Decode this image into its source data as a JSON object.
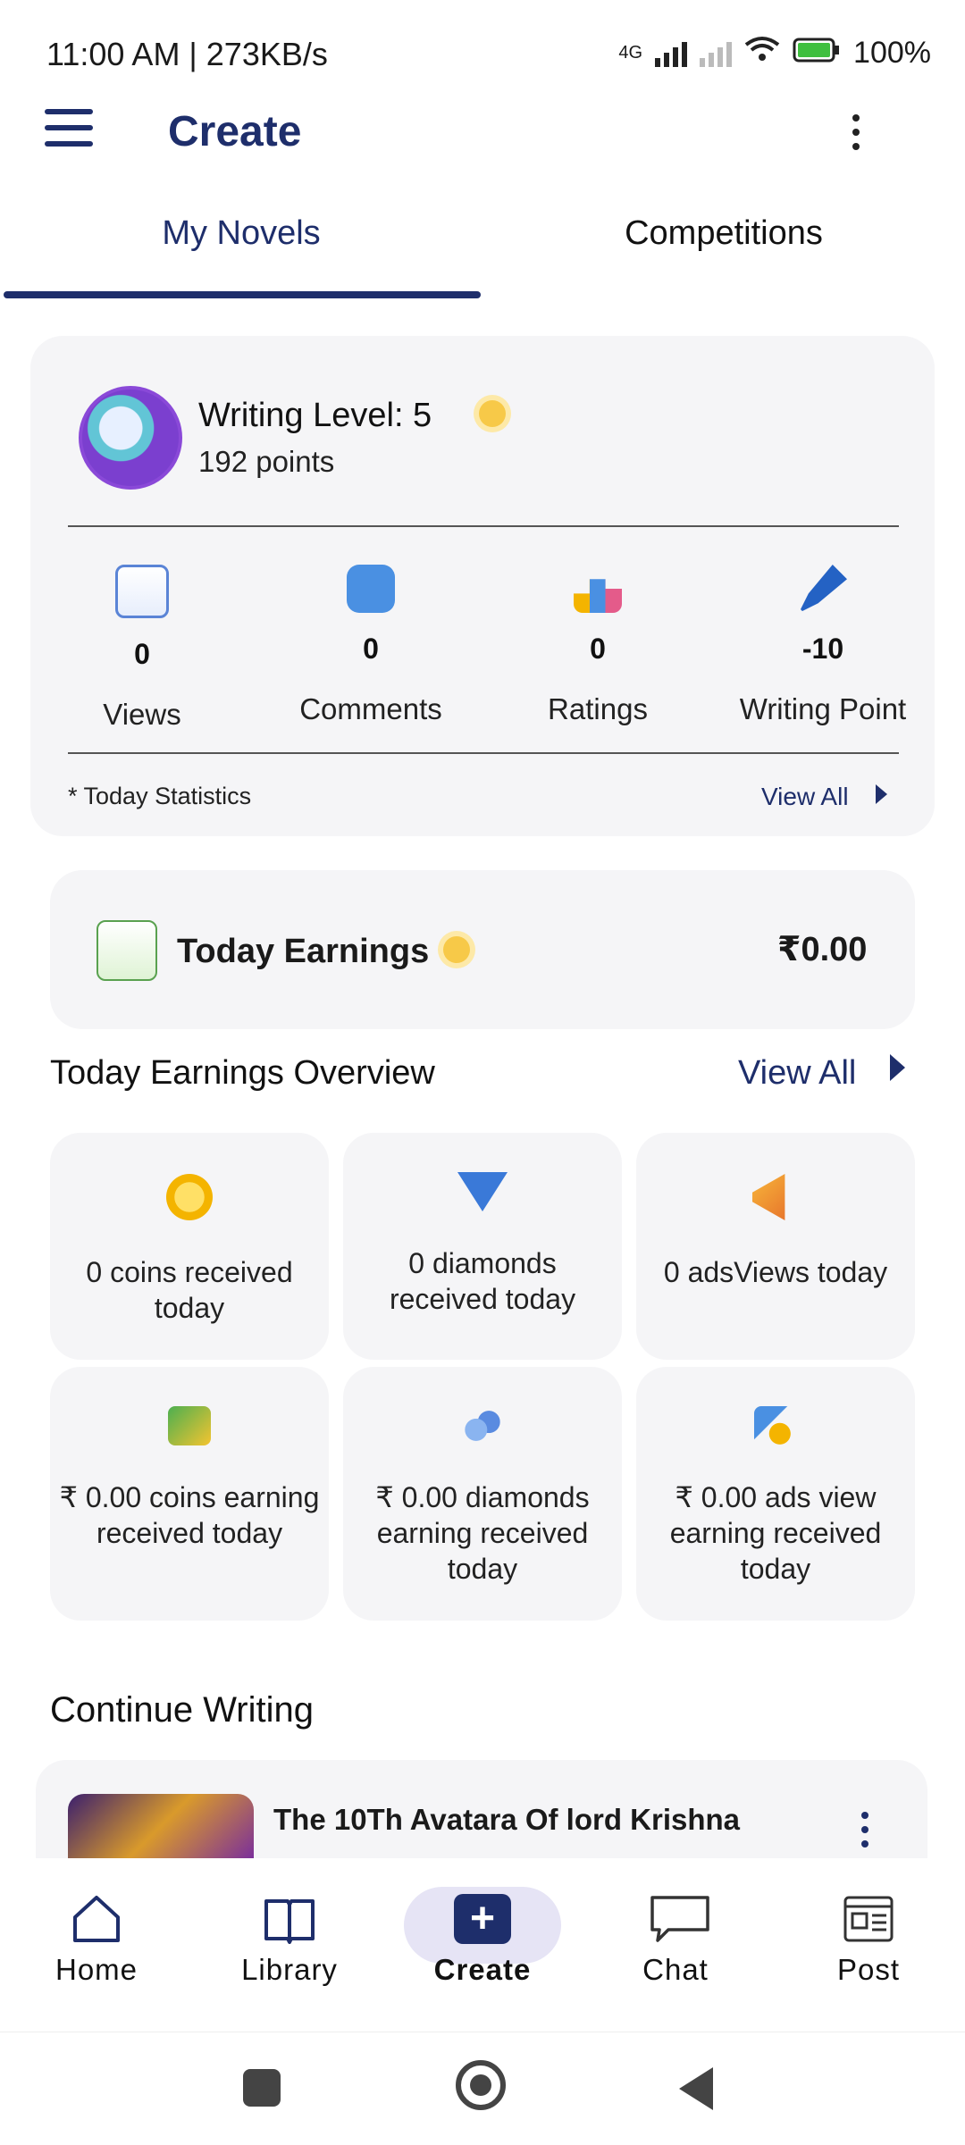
{
  "status_bar": {
    "time": "11:00 AM | 273KB/s",
    "network": "4G",
    "battery": "100%"
  },
  "app_bar": {
    "title": "Create"
  },
  "tabs": [
    {
      "label": "My Novels",
      "selected": true
    },
    {
      "label": "Competitions",
      "selected": false
    }
  ],
  "stats": {
    "level": "Writing Level: 5",
    "points": "192 points",
    "items": [
      {
        "value": "0",
        "label": "Views",
        "icon": "views-chart-icon"
      },
      {
        "value": "0",
        "label": "Comments",
        "icon": "comments-icon"
      },
      {
        "value": "0",
        "label": "Ratings",
        "icon": "ratings-icon"
      },
      {
        "value": "-10",
        "label": "Writing Point",
        "icon": "pen-icon"
      }
    ],
    "note": "* Today Statistics",
    "view_all": "View All"
  },
  "earnings": {
    "title": "Today Earnings",
    "amount": "₹0.00"
  },
  "overview": {
    "title": "Today Earnings Overview",
    "view_all": "View All",
    "tiles": [
      {
        "text": "0 coins received today",
        "icon": "coin-icon"
      },
      {
        "text": "0 diamonds received today",
        "icon": "diamond-icon"
      },
      {
        "text": "0 adsViews today",
        "icon": "megaphone-icon"
      },
      {
        "text": "₹ 0.00 coins earning received today",
        "icon": "cash-icon"
      },
      {
        "text": "₹ 0.00 diamonds earning received today",
        "icon": "coin-stack-icon"
      },
      {
        "text": "₹ 0.00 ads view earning received today",
        "icon": "ads-earning-icon"
      }
    ]
  },
  "continue_writing": {
    "title": "Continue Writing",
    "book_title": "The 10Th Avatara Of lord Krishna"
  },
  "bottom_nav": [
    {
      "label": "Home",
      "icon": "home-icon"
    },
    {
      "label": "Library",
      "icon": "book-icon"
    },
    {
      "label": "Create",
      "icon": "plus-icon",
      "active": true
    },
    {
      "label": "Chat",
      "icon": "chat-bubble-icon"
    },
    {
      "label": "Post",
      "icon": "post-icon"
    }
  ]
}
